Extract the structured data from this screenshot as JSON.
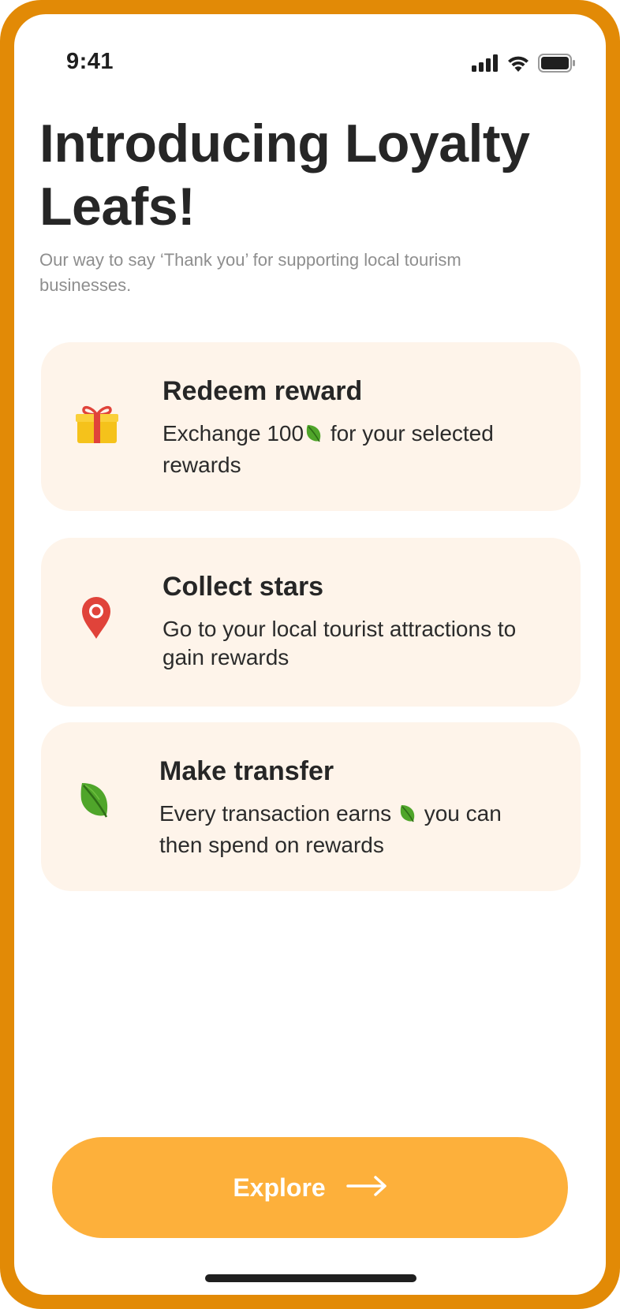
{
  "status_bar": {
    "time": "9:41",
    "icons": [
      "cellular-signal-icon",
      "wifi-icon",
      "battery-icon"
    ]
  },
  "header": {
    "title": "Introducing Loyalty Leafs!",
    "subtitle": "Our way to say ‘Thank you’ for supporting local tourism businesses."
  },
  "cards": [
    {
      "icon": "gift-icon",
      "title": "Redeem reward",
      "desc_before": "Exchange 100",
      "desc_after": " for your selected rewards"
    },
    {
      "icon": "map-pin-icon",
      "title": "Collect stars",
      "desc": "Go to your local tourist attractions to gain rewards"
    },
    {
      "icon": "leaf-icon",
      "title": "Make transfer",
      "desc_before": "Every transaction earns ",
      "desc_after": " you can then spend on rewards"
    }
  ],
  "explore_button": {
    "label": "Explore",
    "icon": "arrow-right-icon"
  },
  "colors": {
    "frame": "#E28A06",
    "card_background": "#FEF4EA",
    "button": "#FDB03B",
    "title_text": "#262626",
    "subtitle_text": "#8E8E8E"
  }
}
